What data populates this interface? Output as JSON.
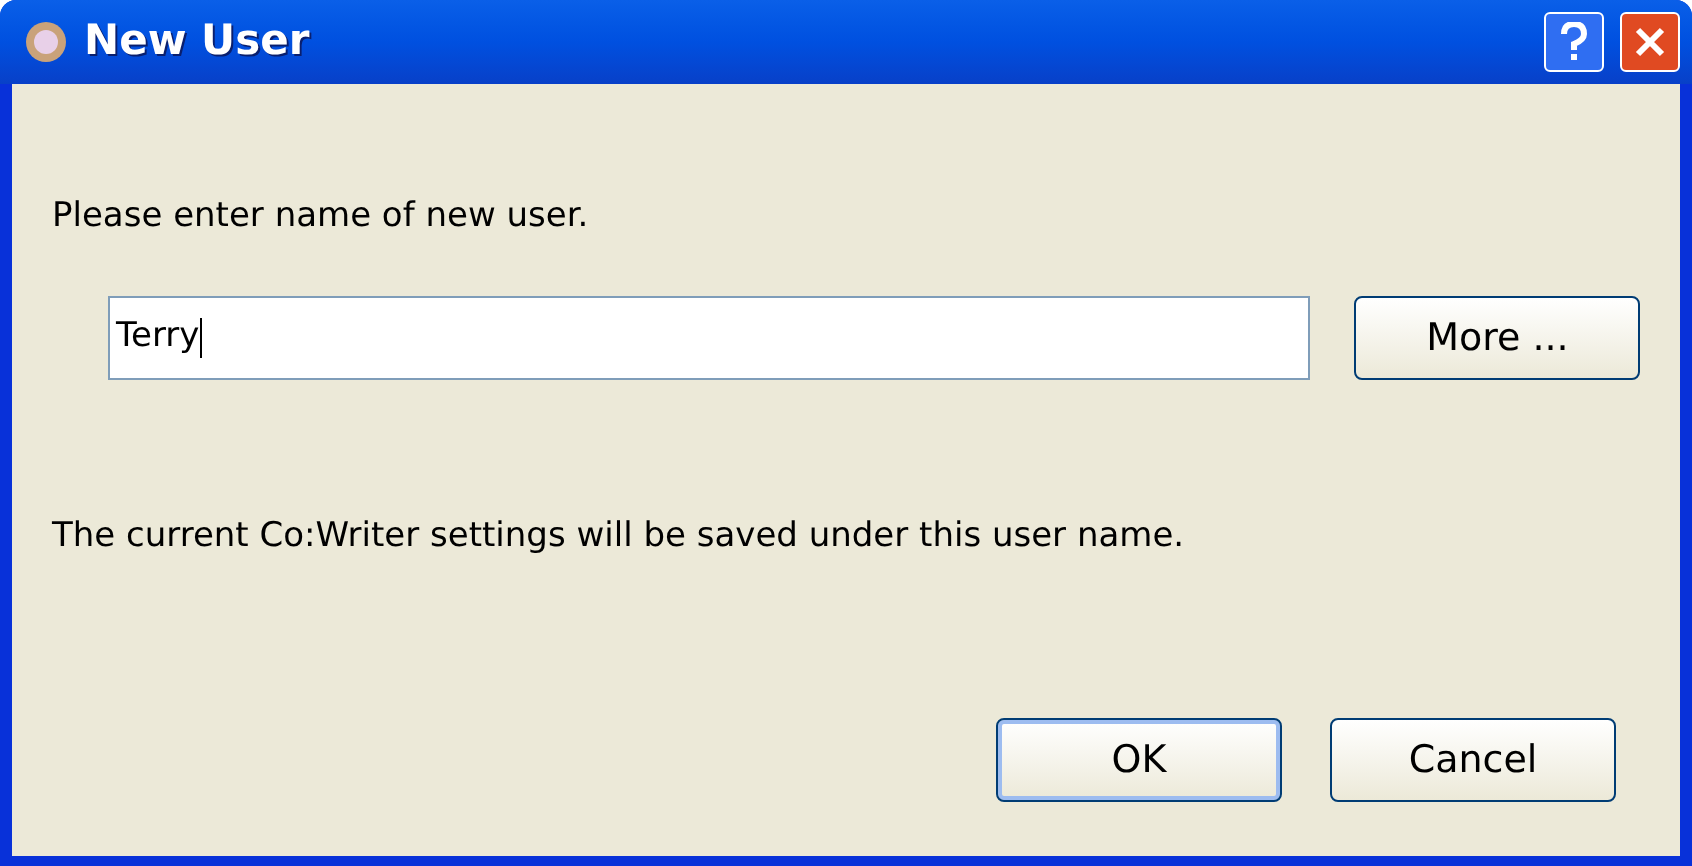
{
  "window": {
    "title": "New User"
  },
  "prompt": "Please enter name of new user.",
  "name_field": {
    "value": "Terry",
    "focused": true
  },
  "more_button": "More ...",
  "note": "The current Co:Writer settings will be saved under this user name.",
  "buttons": [
    {
      "label": "OK",
      "default": true
    },
    {
      "label": "Cancel",
      "default": false
    }
  ]
}
